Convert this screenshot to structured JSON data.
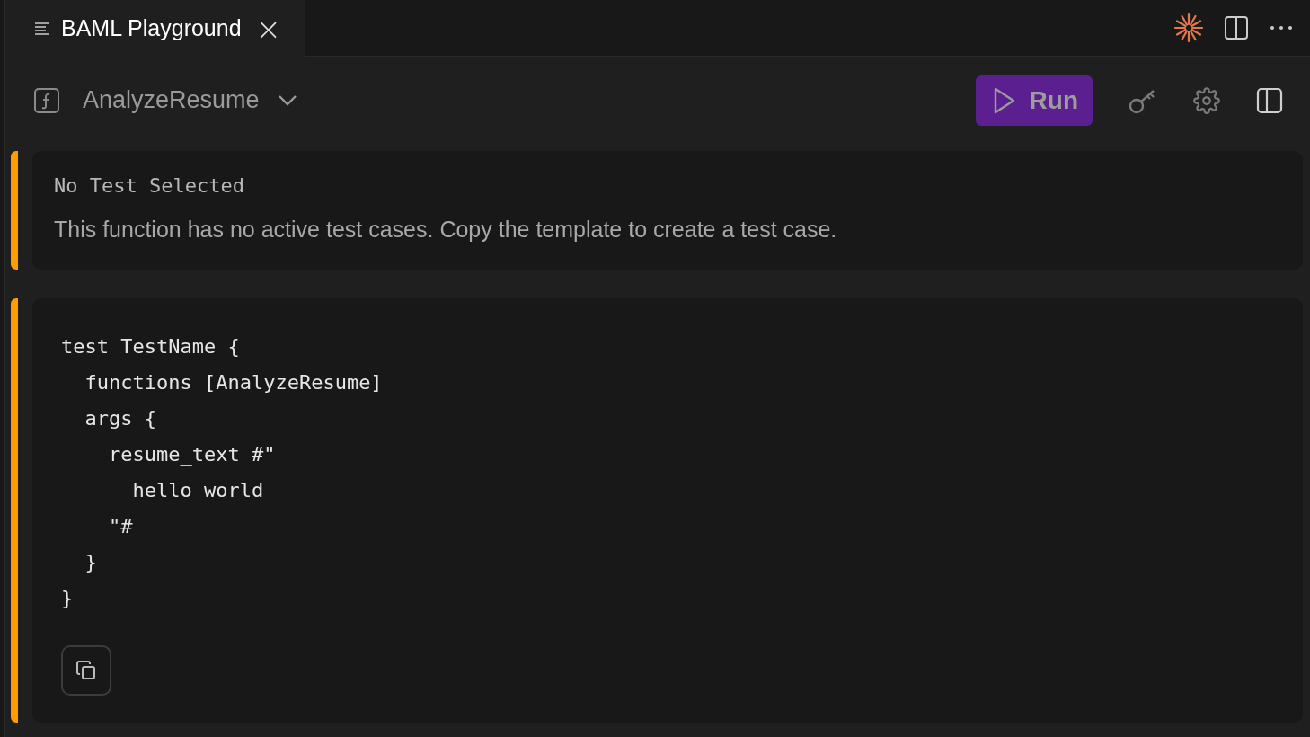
{
  "tab": {
    "title": "BAML Playground",
    "close": "×",
    "selected": true
  },
  "toolbar": {
    "function_name": "AnalyzeResume",
    "run_label": "Run"
  },
  "notice": {
    "title": "No Test Selected",
    "message": "This function has no active test cases. Copy the template to create a test case."
  },
  "template": {
    "lines": [
      "test TestName {",
      "  functions [AnalyzeResume]",
      "  args {",
      "    resume_text #\"",
      "      hello world",
      "    \"#",
      "  }",
      "}"
    ]
  }
}
